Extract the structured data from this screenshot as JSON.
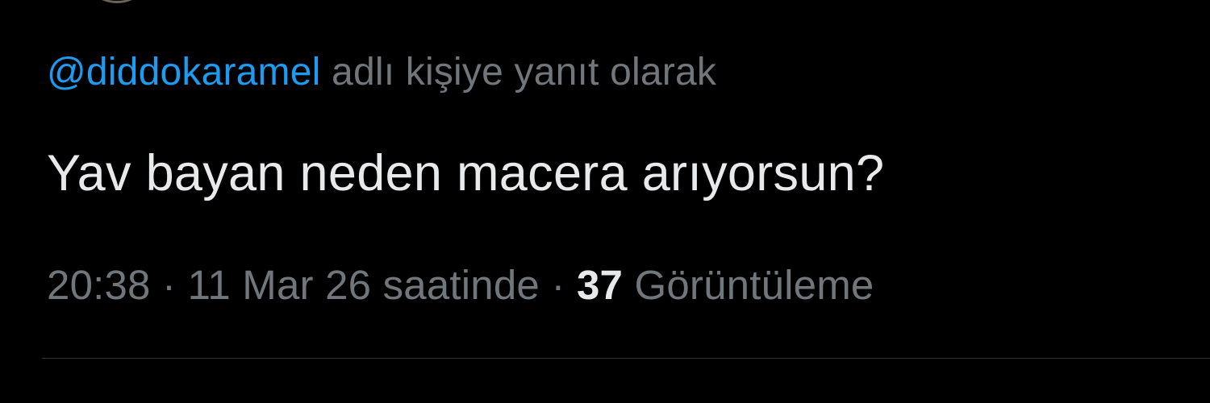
{
  "reply": {
    "mention": "@diddokaramel",
    "suffix": "adlı kişiye yanıt olarak"
  },
  "tweet": {
    "text": "Yav bayan neden macera arıyorsun?"
  },
  "meta": {
    "time": "20:38",
    "separator": "·",
    "date": "11 Mar 26 saatinde",
    "views_count": "37",
    "views_label": "Görüntüleme"
  },
  "colors": {
    "background": "#000000",
    "link": "#1d9bf0",
    "secondary_text": "#71767b",
    "primary_text": "#e7e9ea",
    "divider": "#2f3336"
  }
}
